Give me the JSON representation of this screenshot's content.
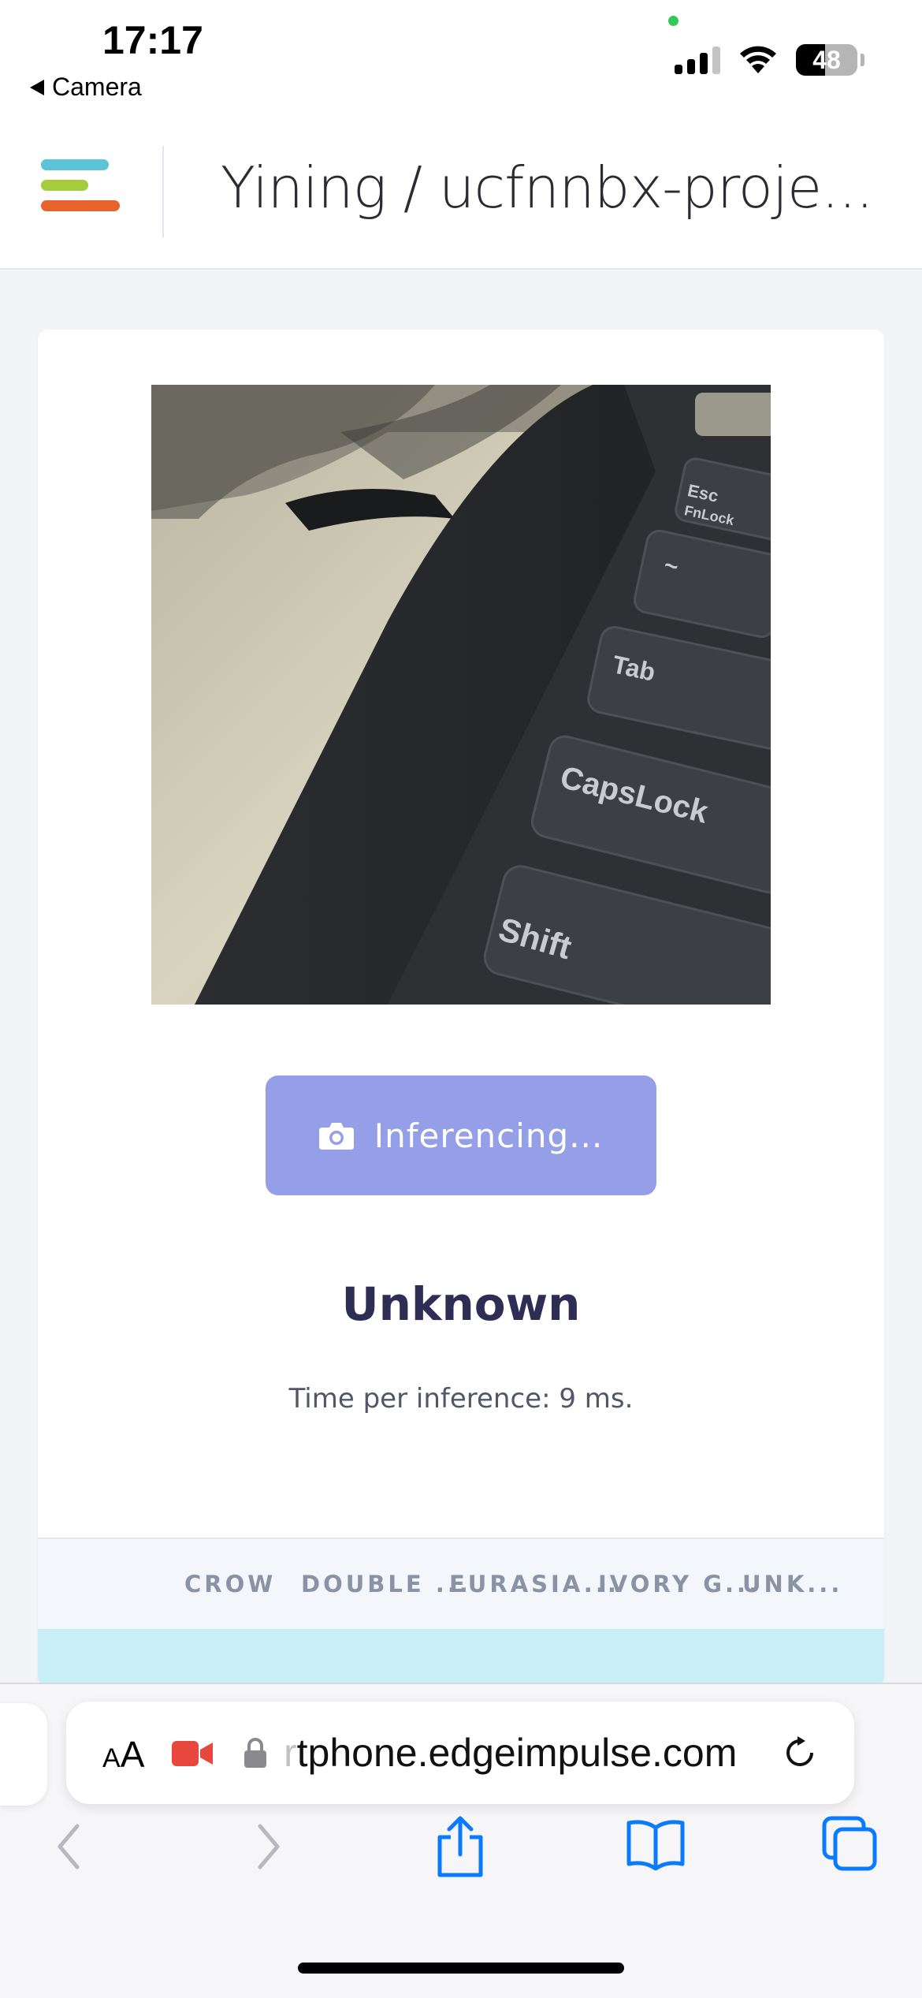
{
  "status_bar": {
    "time": "17:17",
    "back_label": "Camera",
    "battery_level": "48",
    "battery_fraction": 0.48
  },
  "header": {
    "project_title": "Yining / ucfnnbx-proje..."
  },
  "main": {
    "capture_button_label": "Inferencing...",
    "result_label": "Unknown",
    "time_per_inference": "Time per inference: 9 ms.",
    "table_columns": [
      "CROW",
      "DOUBLE ...",
      "EURASIA...",
      "IVORY G...",
      "UNK..."
    ]
  },
  "browser": {
    "text_size_small": "A",
    "text_size_large": "A",
    "url_ghost": "r",
    "url": "tphone.edgeimpulse.com"
  },
  "colors": {
    "accent_button": "#959fe8",
    "logo_blue": "#5ec3d6",
    "logo_green": "#a4cc3d",
    "logo_orange": "#e9632d",
    "ios_blue": "#0a7aff",
    "highlight_row": "#c8eef8"
  },
  "icons": [
    "back-arrow-icon",
    "cellular-signal-icon",
    "wifi-icon",
    "battery-icon",
    "edge-impulse-logo",
    "camera-icon",
    "video-camera-icon",
    "lock-icon",
    "reload-icon",
    "back-chevron-icon",
    "forward-chevron-icon",
    "share-icon",
    "bookmarks-icon",
    "tabs-icon"
  ]
}
